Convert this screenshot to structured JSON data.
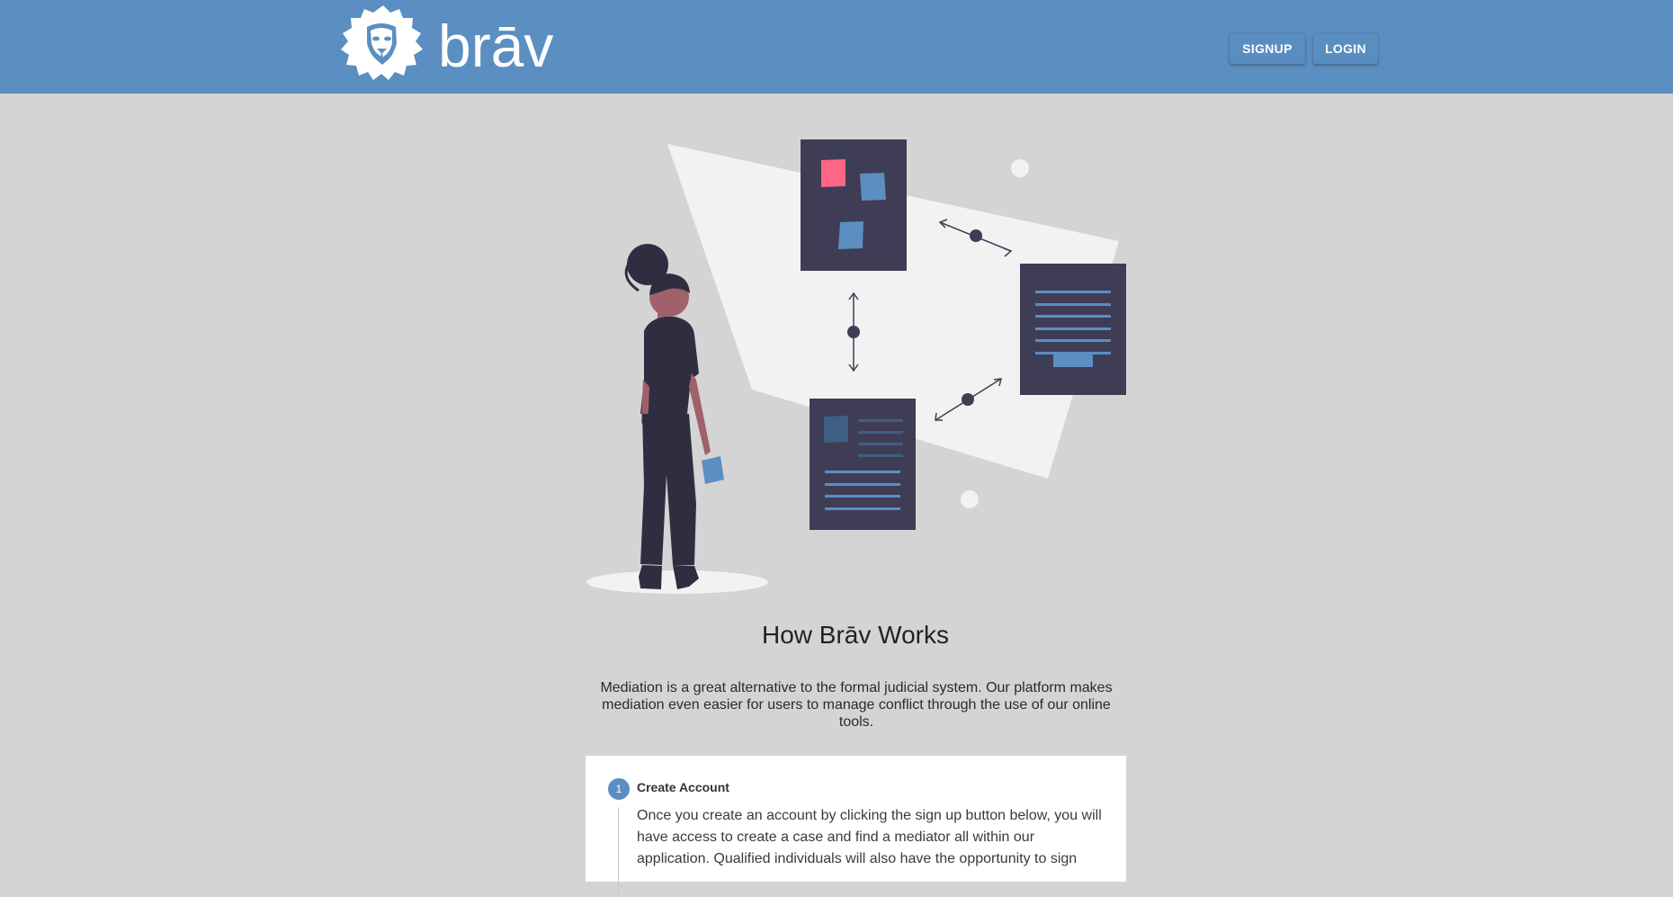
{
  "header": {
    "brand_text": "brāv",
    "signup_label": "SIGNUP",
    "login_label": "LOGIN"
  },
  "main": {
    "title": "How Brāv Works",
    "intro": "Mediation is a great alternative to the formal judicial system. Our platform makes mediation even easier for users to manage conflict through the use of our online tools."
  },
  "steps": [
    {
      "number": "1",
      "title": "Create Account",
      "body": "Once you create an account by clicking the sign up button below, you will have access to create a case and find a mediator all within our application. Qualified individuals will also have the opportunity to sign"
    }
  ],
  "colors": {
    "header_bg": "#5b8ec1",
    "page_bg": "#d4d4d4",
    "dark": "#3f3d56",
    "accent_blue": "#5b8ec1",
    "accent_pink": "#ff6584"
  },
  "icons": {
    "logo": "lion-head-icon"
  }
}
